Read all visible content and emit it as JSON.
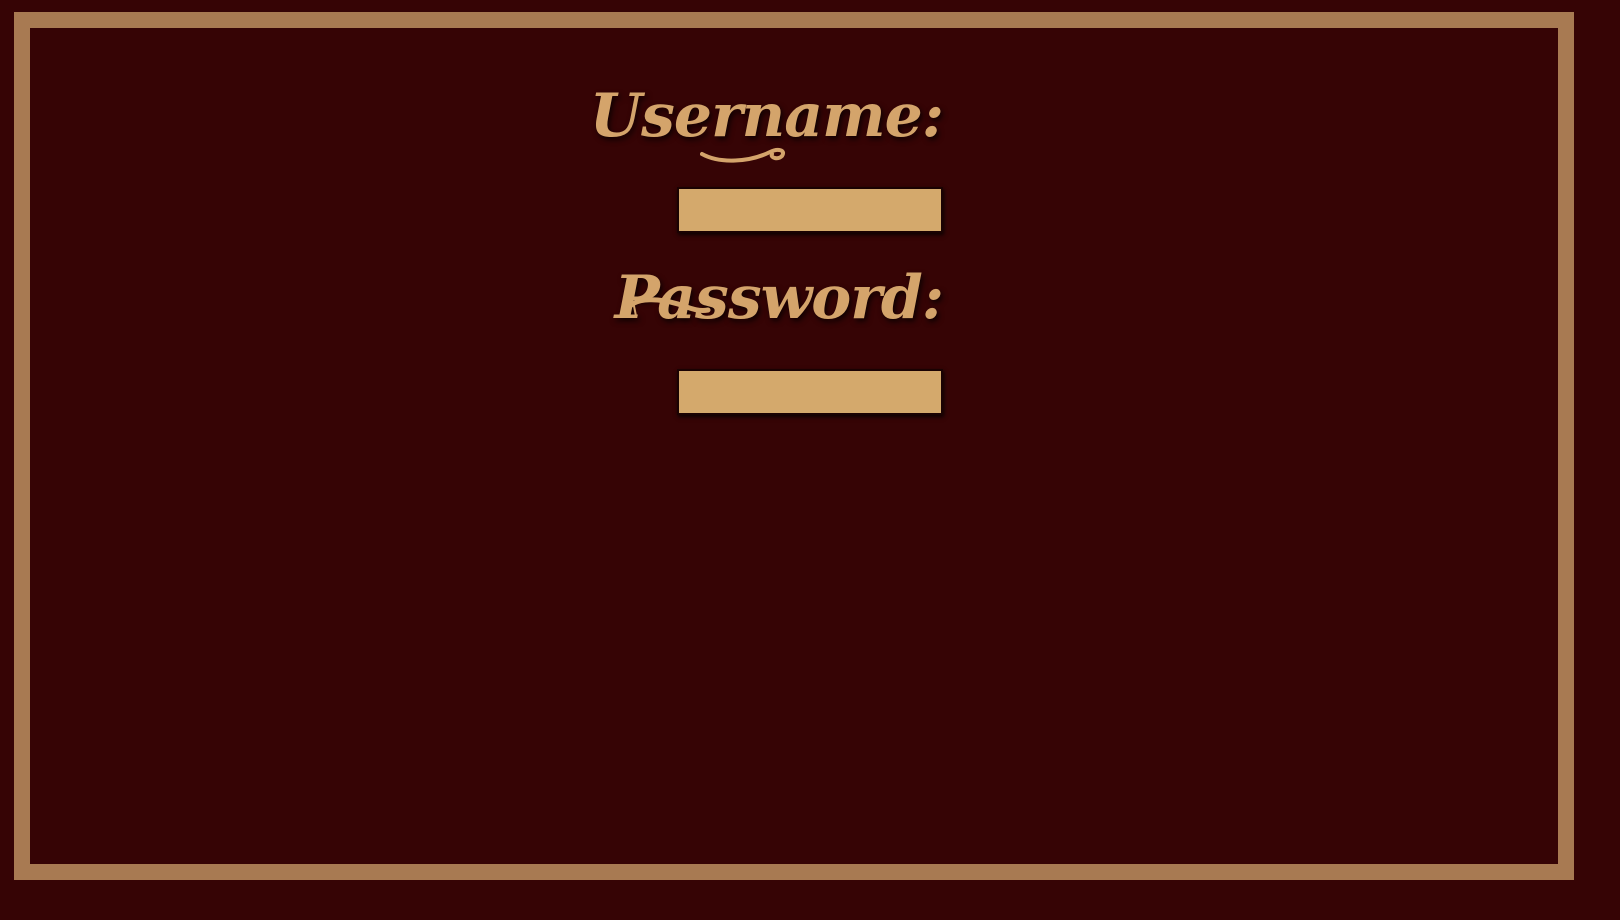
{
  "form": {
    "username_label": "Username:",
    "username_value": "",
    "password_label": "Password:",
    "password_value": ""
  },
  "colors": {
    "background": "#360405",
    "border": "#a87a52",
    "label": "#d4a46b",
    "field": "#d4a96c"
  }
}
